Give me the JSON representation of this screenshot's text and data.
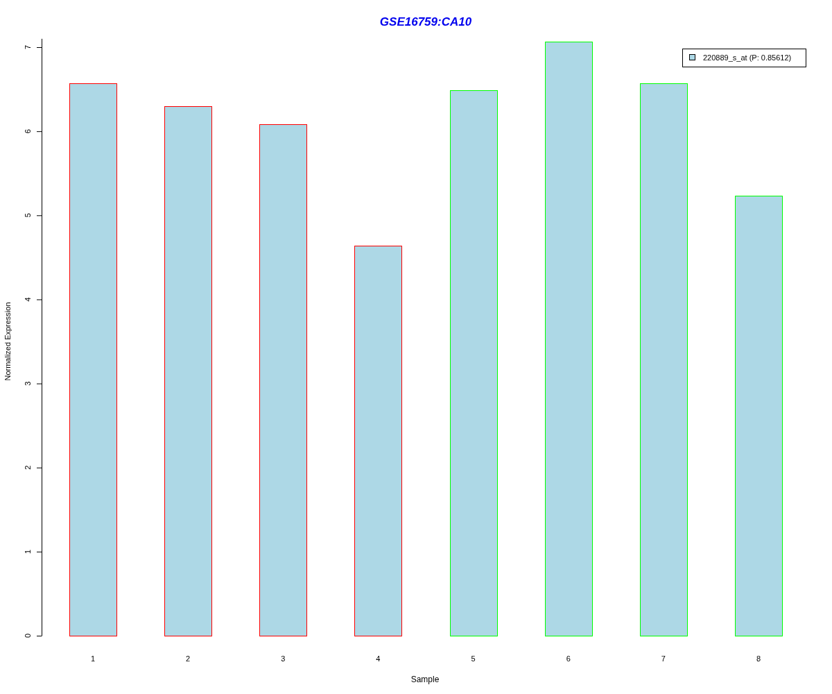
{
  "chart": {
    "chart_data": {
      "type": "bar",
      "title": "GSE16759:CA10",
      "xlabel": "Sample",
      "ylabel": "Normalized Expression",
      "categories": [
        "1",
        "2",
        "3",
        "4",
        "5",
        "6",
        "7",
        "8"
      ],
      "series": [
        {
          "name": "220889_s_at (P: 0.85612)",
          "color": "#add8e6",
          "values": [
            6.57,
            6.3,
            6.08,
            4.64,
            6.49,
            7.07,
            6.57,
            5.23
          ]
        }
      ],
      "ylim": [
        0,
        7.1
      ],
      "yticks": [
        0,
        1,
        2,
        3,
        4,
        5,
        6,
        7
      ]
    },
    "bar_outlines": [
      {
        "color": "#ff0000"
      },
      {
        "color": "#ff0000"
      },
      {
        "color": "#ff0000"
      },
      {
        "color": "#ff0000"
      },
      {
        "color": "#00ff00"
      },
      {
        "color": "#00ff00"
      },
      {
        "color": "#00ff00"
      },
      {
        "color": "#00ff00"
      }
    ]
  }
}
